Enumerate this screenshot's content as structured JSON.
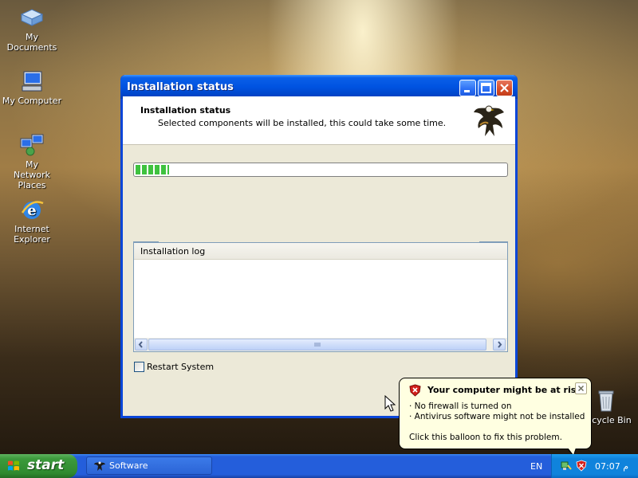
{
  "desktop": {
    "icons": [
      {
        "label": "My Documents"
      },
      {
        "label": "My Computer"
      },
      {
        "label": "My Network Places"
      },
      {
        "label": "Internet Explorer"
      },
      {
        "label": "Recycle Bin"
      }
    ]
  },
  "window": {
    "title": "Installation status",
    "header": {
      "title": "Installation status",
      "subtitle": "Selected components will be installed, this could take some time."
    },
    "progress": {
      "fraction": 0.09
    },
    "log": {
      "header": "Installation log",
      "lines": []
    },
    "restart_checkbox": {
      "label": "Restart System",
      "checked": false
    }
  },
  "balloon": {
    "title": "Your computer might be at risk",
    "lines": [
      "· No firewall is turned on",
      "· Antivirus software might not be installed"
    ],
    "action": "Click this balloon to fix this problem."
  },
  "taskbar": {
    "start_label": "start",
    "task_label": "Software",
    "language": "EN",
    "clock": "07:07 م"
  },
  "colors": {
    "titlebar": "#0053e1",
    "taskbar": "#245edb",
    "start": "#3c9a3c",
    "progress": "#3fc23f",
    "balloon": "#ffffe1"
  }
}
